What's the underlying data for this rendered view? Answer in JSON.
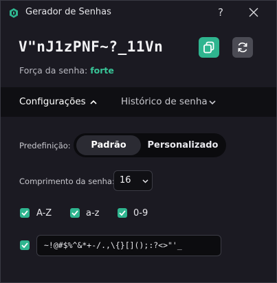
{
  "window": {
    "title": "Gerador de Senhas",
    "help_label": "?"
  },
  "password": {
    "value": "V\"nJ1zPNF~?_11Vn",
    "strength_label": "Força da senha:",
    "strength_value": "forte",
    "accent": "#2fb58f"
  },
  "tabs": [
    {
      "label": "Configurações",
      "active": true,
      "icon": "chevron-up-icon"
    },
    {
      "label": "Histórico de senha",
      "active": false,
      "icon": "chevron-down-icon"
    }
  ],
  "settings": {
    "preset_label": "Predefinição:",
    "preset_options": [
      "Padrão",
      "Personalizado"
    ],
    "preset_selected": "Padrão",
    "length_label": "Comprimento da senha:",
    "length_value": "16",
    "checkboxes": [
      {
        "label": "A-Z",
        "checked": true
      },
      {
        "label": "a-z",
        "checked": true
      },
      {
        "label": "0-9",
        "checked": true
      }
    ],
    "special_checked": true,
    "special_chars": "~!@#$%^&*+-/.,\\{}[]();:?<>\"'_"
  }
}
